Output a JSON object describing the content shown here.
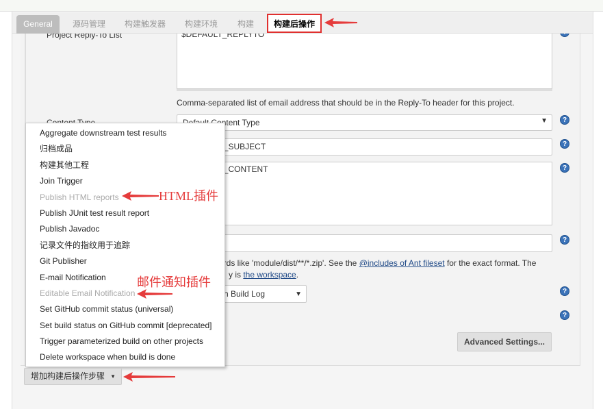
{
  "tabs": [
    {
      "label": "General"
    },
    {
      "label": "源码管理"
    },
    {
      "label": "构建触发器"
    },
    {
      "label": "构建环境"
    },
    {
      "label": "构建"
    },
    {
      "label": "构建后操作"
    }
  ],
  "form": {
    "reply_to_label": "Project Reply-To List",
    "reply_to_value": "$DEFAULT_REPLYTO",
    "reply_to_help": "Comma-separated list of email address that should be in the Reply-To header for this project.",
    "content_type_label": "Content Type",
    "content_type_value": "Default Content Type",
    "subject_value": "$DEFAULT_SUBJECT",
    "content_value": "$DEFAULT_CONTENT",
    "attachments_value": "",
    "attach_help_1": "cards like 'module/dist/**/*.zip'. See the ",
    "attach_help_link": "@includes of Ant fileset",
    "attach_help_2": " for the exact format. The",
    "attach_help_3": "y is ",
    "attach_help_link2": "the workspace",
    "attach_help_4": ".",
    "build_log_value": "h Build Log",
    "advanced_button": "Advanced Settings..."
  },
  "menu": {
    "items": [
      {
        "label": "Aggregate downstream test results",
        "disabled": false
      },
      {
        "label": "归档成品",
        "disabled": false
      },
      {
        "label": "构建其他工程",
        "disabled": false
      },
      {
        "label": "Join Trigger",
        "disabled": false
      },
      {
        "label": "Publish HTML reports",
        "disabled": true
      },
      {
        "label": "Publish JUnit test result report",
        "disabled": false
      },
      {
        "label": "Publish Javadoc",
        "disabled": false
      },
      {
        "label": "记录文件的指纹用于追踪",
        "disabled": false
      },
      {
        "label": "Git Publisher",
        "disabled": false
      },
      {
        "label": "E-mail Notification",
        "disabled": false
      },
      {
        "label": "Editable Email Notification",
        "disabled": true
      },
      {
        "label": "Set GitHub commit status (universal)",
        "disabled": false
      },
      {
        "label": "Set build status on GitHub commit [deprecated]",
        "disabled": false
      },
      {
        "label": "Trigger parameterized build on other projects",
        "disabled": false
      },
      {
        "label": "Delete workspace when build is done",
        "disabled": false
      }
    ]
  },
  "add_step_button": "增加构建后操作步骤",
  "annotations": {
    "html": "HTML插件",
    "email": "邮件通知插件"
  },
  "colors": {
    "annotation": "#e53b3b",
    "help_icon": "#3b73b9"
  }
}
